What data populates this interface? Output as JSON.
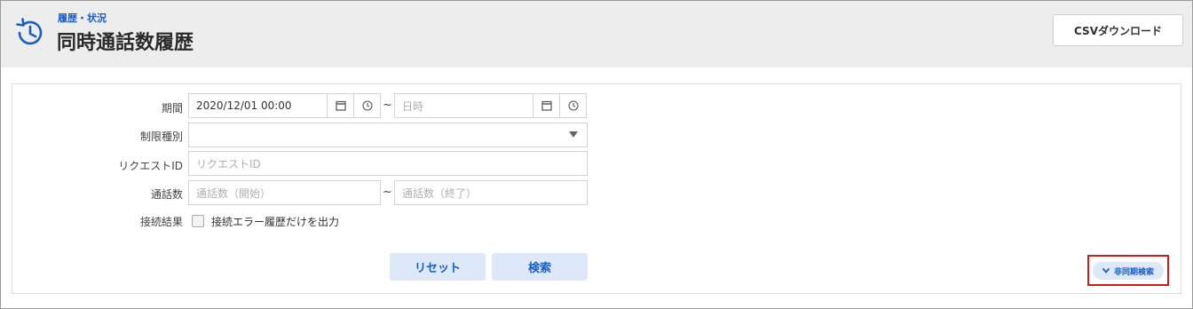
{
  "header": {
    "breadcrumb": "履歴・状況",
    "title": "同時通話数履歴",
    "csv_button": "CSVダウンロード"
  },
  "form": {
    "period": {
      "label": "期間",
      "start_value": "2020/12/01 00:00",
      "separator": "~",
      "end_placeholder": "日時"
    },
    "limit_type": {
      "label": "制限種別",
      "value": ""
    },
    "request_id": {
      "label": "リクエストID",
      "placeholder": "リクエストID"
    },
    "call_count": {
      "label": "通話数",
      "start_placeholder": "通話数（開始）",
      "separator": "~",
      "end_placeholder": "通話数（終了）"
    },
    "connection_result": {
      "label": "接続結果",
      "checkbox_label": "接続エラー履歴だけを出力",
      "checked": false
    }
  },
  "actions": {
    "reset": "リセット",
    "search": "検索",
    "async_search": "非同期検索"
  },
  "colors": {
    "accent": "#1b5cc9",
    "button_bg": "#dde8f8",
    "header_bg": "#ededed",
    "highlight": "#d01b1b"
  }
}
